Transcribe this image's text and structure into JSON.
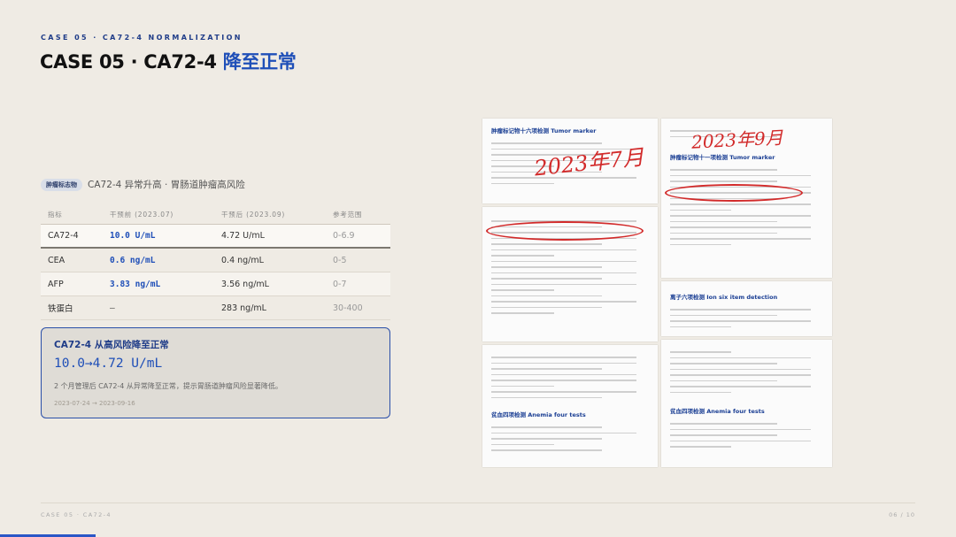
{
  "header": {
    "kicker": "CASE 05 · CA72-4 NORMALIZATION",
    "title_main": "CASE 05 · CA72-4 ",
    "title_accent": "降至正常"
  },
  "tagline": {
    "tag": "肿瘤标志物",
    "desc": "CA72-4 异常升高 · 胃肠道肿瘤高风险"
  },
  "table": {
    "headers": [
      "指标",
      "干预前 (2023.07)",
      "干预后 (2023.09)",
      "参考范围"
    ],
    "rows": [
      {
        "name": "CA72-4",
        "before": "10.0 U/mL",
        "after": "4.72 U/mL",
        "ref": "0-6.9"
      },
      {
        "name": "CEA",
        "before": "0.6 ng/mL",
        "after": "0.4 ng/mL",
        "ref": "0-5"
      },
      {
        "name": "AFP",
        "before": "3.83 ng/mL",
        "after": "3.56 ng/mL",
        "ref": "0-7"
      },
      {
        "name": "铁蛋白",
        "before": "—",
        "after": "283 ng/mL",
        "ref": "30-400"
      }
    ]
  },
  "card": {
    "title": "CA72-4 从高风险降至正常",
    "metric": "10.0→4.72 U/mL",
    "desc": "2 个月管理后 CA72-4 从异常降至正常，提示胃肠道肿瘤风险显著降低。",
    "date": "2023-07-24 → 2023-09-16"
  },
  "docs": {
    "sheet1_header": "肿瘤标记物十六项检测 Tumor marker",
    "sheet1_hand": "2023年7月",
    "sheet2_header": "肿瘤标记物十一项检测 Tumor marker",
    "sheet2_hand": "2023年9月",
    "sheet3_header": "离子六项检测 Ion six item detection",
    "sheet4_header": "贫血四项检测 Anemia four tests",
    "sheet5_header": "贫血四项检测 Anemia four tests"
  },
  "footer": {
    "left": "CASE 05 · CA72-4",
    "right": "06 / 10"
  },
  "progress": {
    "value": 0.1
  },
  "colors": {
    "accent": "#1f4fb8",
    "handwriting": "#d22a2a"
  }
}
